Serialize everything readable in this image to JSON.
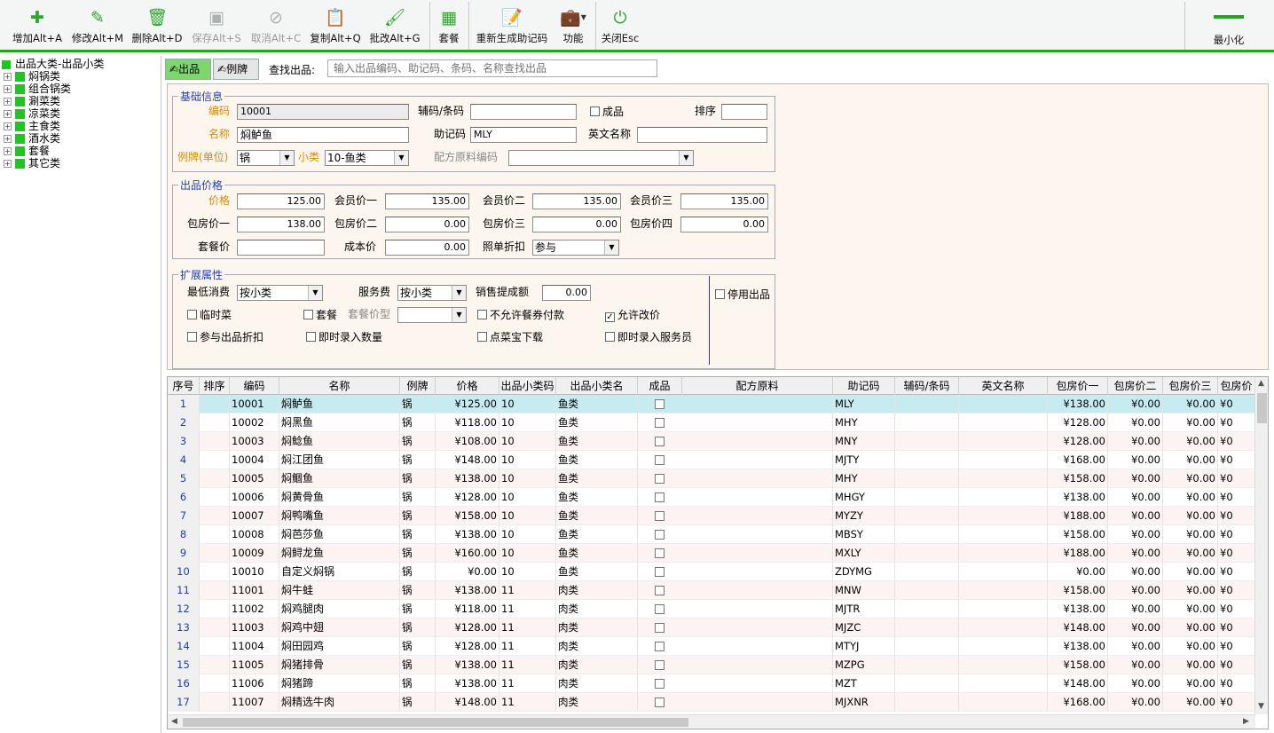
{
  "toolbar": {
    "add": "增加Alt+A",
    "edit": "修改Alt+M",
    "delete": "删除Alt+D",
    "save": "保存Alt+S",
    "cancel": "取消Alt+C",
    "copy": "复制Alt+Q",
    "batch": "批改Alt+G",
    "setmeal": "套餐",
    "regen": "重新生成助记码",
    "function": "功能",
    "close": "关闭Esc",
    "minimize": "最小化",
    "accent_color": "#22a322"
  },
  "tree": {
    "root": "出品大类-出品小类",
    "items": [
      "焖锅类",
      "组合锅类",
      "涮菜类",
      "凉菜类",
      "主食类",
      "酒水类",
      "套餐",
      "其它类"
    ]
  },
  "tabs": {
    "product": "出品",
    "unit": "例牌"
  },
  "search": {
    "label": "查找出品:",
    "placeholder": "输入出品编码、助记码、条码、名称查找出品"
  },
  "basic": {
    "legend": "基础信息",
    "code_label": "编码",
    "code_value": "10001",
    "barcode_label": "辅码/条码",
    "barcode_value": "",
    "finished_label": "成品",
    "sort_label": "排序",
    "sort_value": "",
    "name_label": "名称",
    "name_value": "焖鲈鱼",
    "mnemonic_label": "助记码",
    "mnemonic_value": "MLY",
    "english_label": "英文名称",
    "english_value": "",
    "unit_label": "例牌(单位)",
    "unit_value": "锅",
    "subcat_label": "小类",
    "subcat_value": "10-鱼类",
    "recipe_label": "配方原料编码",
    "recipe_value": ""
  },
  "price": {
    "legend": "出品价格",
    "price_label": "价格",
    "price_value": "125.00",
    "member1_label": "会员价一",
    "member1_value": "135.00",
    "member2_label": "会员价二",
    "member2_value": "135.00",
    "member3_label": "会员价三",
    "member3_value": "135.00",
    "room1_label": "包房价一",
    "room1_value": "138.00",
    "room2_label": "包房价二",
    "room2_value": "0.00",
    "room3_label": "包房价三",
    "room3_value": "0.00",
    "room4_label": "包房价四",
    "room4_value": "0.00",
    "setmeal_label": "套餐价",
    "setmeal_value": "",
    "cost_label": "成本价",
    "cost_value": "0.00",
    "discount_label": "照单折扣",
    "discount_value": "参与"
  },
  "ext": {
    "legend": "扩展属性",
    "minspend_label": "最低消费",
    "minspend_value": "按小类",
    "service_label": "服务费",
    "service_value": "按小类",
    "commission_label": "销售提成额",
    "commission_value": "0.00",
    "temp_label": "临时菜",
    "setmeal_label": "套餐",
    "setmeal_type_label": "套餐价型",
    "no_coupon_label": "不允许餐券付款",
    "allow_price_change_label": "允许改价",
    "allow_price_change_checked": true,
    "join_discount_label": "参与出品折扣",
    "enter_qty_label": "即时录入数量",
    "download_label": "点菜宝下载",
    "enter_waiter_label": "即时录入服务员",
    "disable_label": "停用出品"
  },
  "grid": {
    "columns": [
      "序号",
      "排序",
      "编码",
      "名称",
      "例牌",
      "价格",
      "出品小类码",
      "出品小类名",
      "成品",
      "配方原料",
      "助记码",
      "辅码/条码",
      "英文名称",
      "包房价一",
      "包房价二",
      "包房价三",
      "包房价"
    ],
    "rows": [
      {
        "no": "1",
        "code": "10001",
        "name": "焖鲈鱼",
        "unit": "锅",
        "price": "¥125.00",
        "subcode": "10",
        "subname": "鱼类",
        "mnemonic": "MLY",
        "room1": "¥138.00",
        "room2": "¥0.00",
        "room3": "¥0.00",
        "room4": "¥0"
      },
      {
        "no": "2",
        "code": "10002",
        "name": "焖黑鱼",
        "unit": "锅",
        "price": "¥118.00",
        "subcode": "10",
        "subname": "鱼类",
        "mnemonic": "MHY",
        "room1": "¥128.00",
        "room2": "¥0.00",
        "room3": "¥0.00",
        "room4": "¥0"
      },
      {
        "no": "3",
        "code": "10003",
        "name": "焖鲶鱼",
        "unit": "锅",
        "price": "¥108.00",
        "subcode": "10",
        "subname": "鱼类",
        "mnemonic": "MNY",
        "room1": "¥128.00",
        "room2": "¥0.00",
        "room3": "¥0.00",
        "room4": "¥0"
      },
      {
        "no": "4",
        "code": "10004",
        "name": "焖江团鱼",
        "unit": "锅",
        "price": "¥148.00",
        "subcode": "10",
        "subname": "鱼类",
        "mnemonic": "MJTY",
        "room1": "¥168.00",
        "room2": "¥0.00",
        "room3": "¥0.00",
        "room4": "¥0"
      },
      {
        "no": "5",
        "code": "10005",
        "name": "焖鲴鱼",
        "unit": "锅",
        "price": "¥138.00",
        "subcode": "10",
        "subname": "鱼类",
        "mnemonic": "MHY",
        "room1": "¥158.00",
        "room2": "¥0.00",
        "room3": "¥0.00",
        "room4": "¥0"
      },
      {
        "no": "6",
        "code": "10006",
        "name": "焖黄骨鱼",
        "unit": "锅",
        "price": "¥128.00",
        "subcode": "10",
        "subname": "鱼类",
        "mnemonic": "MHGY",
        "room1": "¥138.00",
        "room2": "¥0.00",
        "room3": "¥0.00",
        "room4": "¥0"
      },
      {
        "no": "7",
        "code": "10007",
        "name": "焖鸭嘴鱼",
        "unit": "锅",
        "price": "¥158.00",
        "subcode": "10",
        "subname": "鱼类",
        "mnemonic": "MYZY",
        "room1": "¥188.00",
        "room2": "¥0.00",
        "room3": "¥0.00",
        "room4": "¥0"
      },
      {
        "no": "8",
        "code": "10008",
        "name": "焖芭莎鱼",
        "unit": "锅",
        "price": "¥138.00",
        "subcode": "10",
        "subname": "鱼类",
        "mnemonic": "MBSY",
        "room1": "¥158.00",
        "room2": "¥0.00",
        "room3": "¥0.00",
        "room4": "¥0"
      },
      {
        "no": "9",
        "code": "10009",
        "name": "焖鲟龙鱼",
        "unit": "锅",
        "price": "¥160.00",
        "subcode": "10",
        "subname": "鱼类",
        "mnemonic": "MXLY",
        "room1": "¥188.00",
        "room2": "¥0.00",
        "room3": "¥0.00",
        "room4": "¥0"
      },
      {
        "no": "10",
        "code": "10010",
        "name": "自定义焖锅",
        "unit": "锅",
        "price": "¥0.00",
        "subcode": "10",
        "subname": "鱼类",
        "mnemonic": "ZDYMG",
        "room1": "¥0.00",
        "room2": "¥0.00",
        "room3": "¥0.00",
        "room4": "¥0"
      },
      {
        "no": "11",
        "code": "11001",
        "name": "焖牛蛙",
        "unit": "锅",
        "price": "¥138.00",
        "subcode": "11",
        "subname": "肉类",
        "mnemonic": "MNW",
        "room1": "¥158.00",
        "room2": "¥0.00",
        "room3": "¥0.00",
        "room4": "¥0"
      },
      {
        "no": "12",
        "code": "11002",
        "name": "焖鸡腿肉",
        "unit": "锅",
        "price": "¥118.00",
        "subcode": "11",
        "subname": "肉类",
        "mnemonic": "MJTR",
        "room1": "¥138.00",
        "room2": "¥0.00",
        "room3": "¥0.00",
        "room4": "¥0"
      },
      {
        "no": "13",
        "code": "11003",
        "name": "焖鸡中翅",
        "unit": "锅",
        "price": "¥128.00",
        "subcode": "11",
        "subname": "肉类",
        "mnemonic": "MJZC",
        "room1": "¥148.00",
        "room2": "¥0.00",
        "room3": "¥0.00",
        "room4": "¥0"
      },
      {
        "no": "14",
        "code": "11004",
        "name": "焖田园鸡",
        "unit": "锅",
        "price": "¥128.00",
        "subcode": "11",
        "subname": "肉类",
        "mnemonic": "MTYJ",
        "room1": "¥138.00",
        "room2": "¥0.00",
        "room3": "¥0.00",
        "room4": "¥0"
      },
      {
        "no": "15",
        "code": "11005",
        "name": "焖猪排骨",
        "unit": "锅",
        "price": "¥138.00",
        "subcode": "11",
        "subname": "肉类",
        "mnemonic": "MZPG",
        "room1": "¥158.00",
        "room2": "¥0.00",
        "room3": "¥0.00",
        "room4": "¥0"
      },
      {
        "no": "16",
        "code": "11006",
        "name": "焖猪蹄",
        "unit": "锅",
        "price": "¥138.00",
        "subcode": "11",
        "subname": "肉类",
        "mnemonic": "MZT",
        "room1": "¥148.00",
        "room2": "¥0.00",
        "room3": "¥0.00",
        "room4": "¥0"
      },
      {
        "no": "17",
        "code": "11007",
        "name": "焖精选牛肉",
        "unit": "锅",
        "price": "¥148.00",
        "subcode": "11",
        "subname": "肉类",
        "mnemonic": "MJXNR",
        "room1": "¥168.00",
        "room2": "¥0.00",
        "room3": "¥0.00",
        "room4": "¥0"
      }
    ]
  },
  "colors": {
    "selected_row": "#c6ecf2",
    "odd_row": "#fdf3f3",
    "form_bg": "#fdf6ee",
    "legend": "#1f3fb5",
    "required_label": "#e08a00"
  }
}
